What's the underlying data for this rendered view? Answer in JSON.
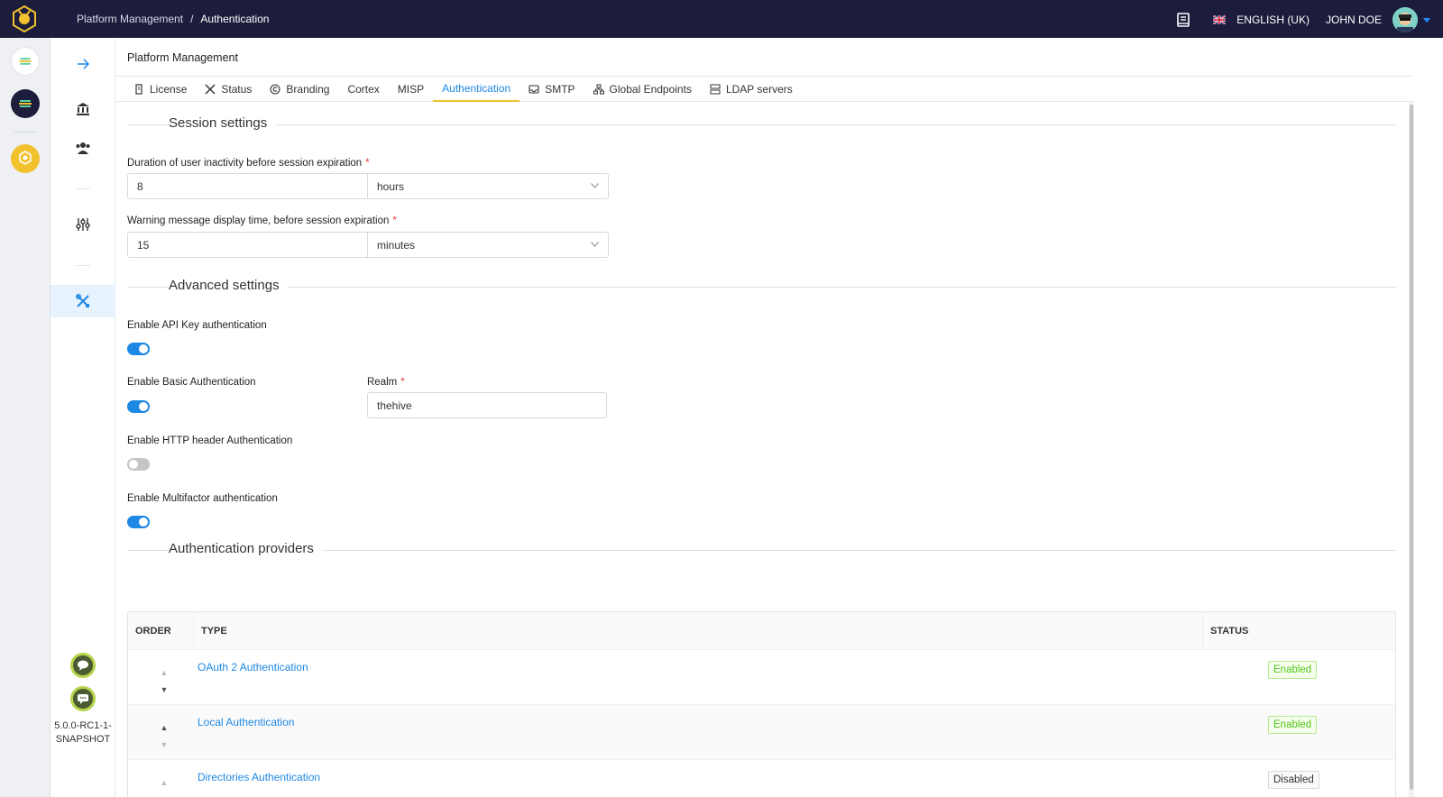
{
  "topbar": {
    "breadcrumb_parent": "Platform Management",
    "breadcrumb_separator": "/",
    "breadcrumb_current": "Authentication",
    "language": "ENGLISH (UK)",
    "user": "JOHN DOE"
  },
  "sidebar": {
    "version": "5.0.0-RC1-1-SNAPSHOT"
  },
  "page": {
    "title": "Platform Management"
  },
  "tabs": [
    {
      "label": "License",
      "icon": "license-icon"
    },
    {
      "label": "Status",
      "icon": "tools-icon"
    },
    {
      "label": "Branding",
      "icon": "copyright-icon"
    },
    {
      "label": "Cortex",
      "icon": ""
    },
    {
      "label": "MISP",
      "icon": ""
    },
    {
      "label": "Authentication",
      "icon": "",
      "active": true
    },
    {
      "label": "SMTP",
      "icon": "inbox-icon"
    },
    {
      "label": "Global Endpoints",
      "icon": "network-icon"
    },
    {
      "label": "LDAP servers",
      "icon": "server-icon"
    }
  ],
  "session": {
    "heading": "Session settings",
    "inactivity_label": "Duration of user inactivity before session expiration",
    "inactivity_value": "8",
    "inactivity_unit": "hours",
    "warning_label": "Warning message display time, before session expiration",
    "warning_value": "15",
    "warning_unit": "minutes",
    "required_mark": "*"
  },
  "advanced": {
    "heading": "Advanced settings",
    "api_key_label": "Enable API Key authentication",
    "api_key_enabled": true,
    "basic_label": "Enable Basic Authentication",
    "basic_enabled": true,
    "realm_label": "Realm",
    "realm_value": "thehive",
    "http_header_label": "Enable HTTP header Authentication",
    "http_header_enabled": false,
    "mfa_label": "Enable Multifactor authentication",
    "mfa_enabled": true
  },
  "providers": {
    "heading": "Authentication providers",
    "columns": {
      "order": "ORDER",
      "type": "TYPE",
      "status": "STATUS"
    },
    "rows": [
      {
        "type": "OAuth 2 Authentication",
        "status": "Enabled"
      },
      {
        "type": "Local Authentication",
        "status": "Enabled"
      },
      {
        "type": "Directories Authentication",
        "status": "Disabled"
      }
    ],
    "arrow_up": "▲",
    "arrow_down": "▼"
  },
  "colors": {
    "topbar": "#1c1d3c",
    "accent": "#1e88e5",
    "tab_underline": "#f2c12e",
    "enabled": "#52c41a"
  }
}
